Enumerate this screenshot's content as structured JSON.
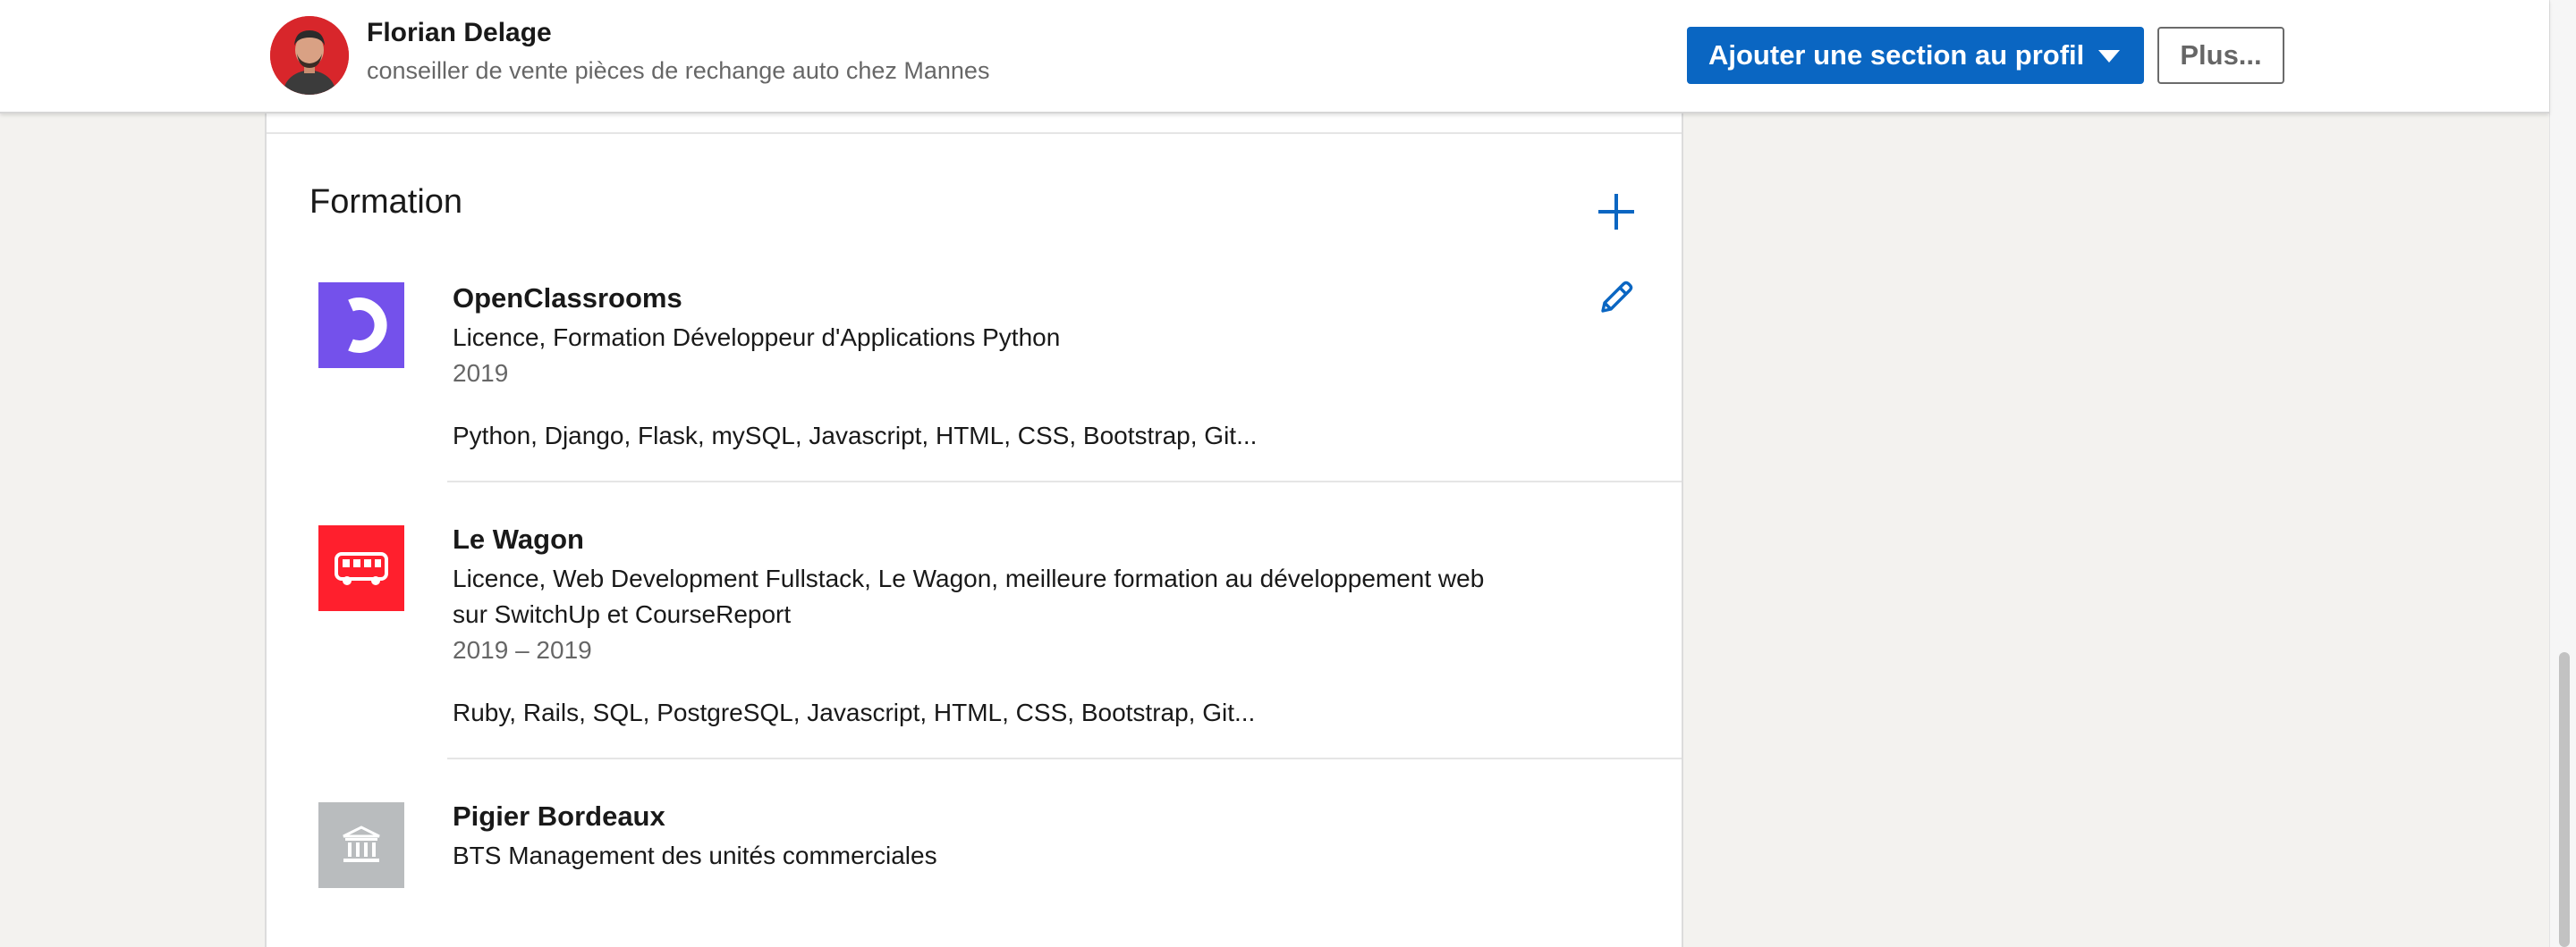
{
  "topbar": {
    "name": "Florian Delage",
    "headline": "conseiller de vente pièces de rechange auto chez Mannes",
    "add_section_label": "Ajouter une section au profil",
    "more_label": "Plus..."
  },
  "section": {
    "title": "Formation",
    "entries": [
      {
        "school": "OpenClassrooms",
        "degree": "Licence, Formation Développeur d'Applications Python",
        "dates": "2019",
        "skills": "Python, Django, Flask, mySQL, Javascript, HTML, CSS, Bootstrap, Git...",
        "logo_color": "#7451eb",
        "logo_icon": "openclassrooms-logo"
      },
      {
        "school": "Le Wagon",
        "degree_line1": "Licence, Web Development Fullstack, Le Wagon, meilleure formation au développement web",
        "degree_line2": "sur SwitchUp et CourseReport",
        "dates": "2019 – 2019",
        "skills": "Ruby, Rails, SQL, PostgreSQL, Javascript, HTML, CSS, Bootstrap, Git...",
        "logo_color": "#ff1f2d",
        "logo_icon": "bus-icon"
      },
      {
        "school": "Pigier Bordeaux",
        "degree": "BTS Management des unités commerciales",
        "logo_color": "#b9bcbe",
        "logo_icon": "school-building-icon"
      }
    ]
  },
  "colors": {
    "accent": "#0a66c2",
    "background": "#f3f2ef"
  }
}
